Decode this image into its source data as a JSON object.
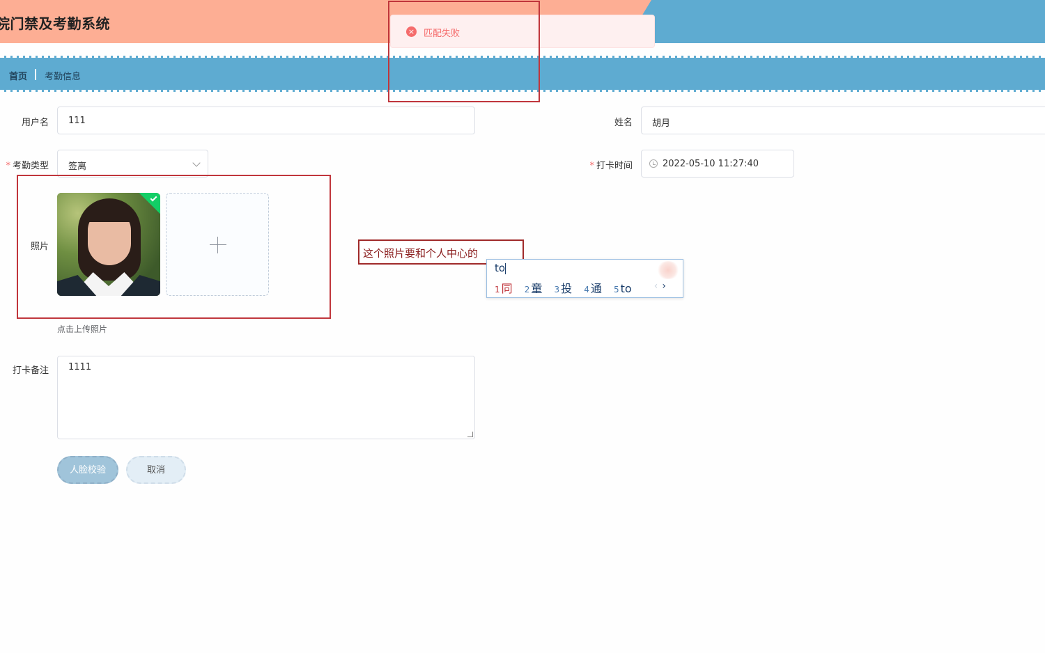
{
  "header": {
    "app_title": "院门禁及考勤系统"
  },
  "breadcrumb": {
    "home": "首页",
    "current": "考勤信息"
  },
  "form": {
    "username": {
      "label": "用户名",
      "value": "111"
    },
    "name": {
      "label": "姓名",
      "value": "胡月"
    },
    "attendance_type": {
      "label": "考勤类型",
      "value": "签离"
    },
    "punch_time": {
      "label": "打卡时间",
      "value": "2022-05-10 11:27:40"
    },
    "photo": {
      "label": "照片",
      "hint": "点击上传照片"
    },
    "remark": {
      "label": "打卡备注",
      "value": "1111"
    },
    "required_mark": "*"
  },
  "buttons": {
    "verify": "人脸校验",
    "cancel": "取消"
  },
  "toast": {
    "message": "匹配失败",
    "icon": "error-circle-icon"
  },
  "annotation": {
    "text": "这个照片要和个人中心的"
  },
  "ime": {
    "input": "to",
    "candidates": [
      {
        "num": "1",
        "text": "同"
      },
      {
        "num": "2",
        "text": "童"
      },
      {
        "num": "3",
        "text": "投"
      },
      {
        "num": "4",
        "text": "通"
      },
      {
        "num": "5",
        "text": "to"
      }
    ],
    "prev": "‹",
    "next": "›"
  },
  "colors": {
    "header_orange": "#fdae94",
    "header_blue": "#5eabd1",
    "error": "#f56c6c",
    "annotation_red": "#c0363c"
  }
}
